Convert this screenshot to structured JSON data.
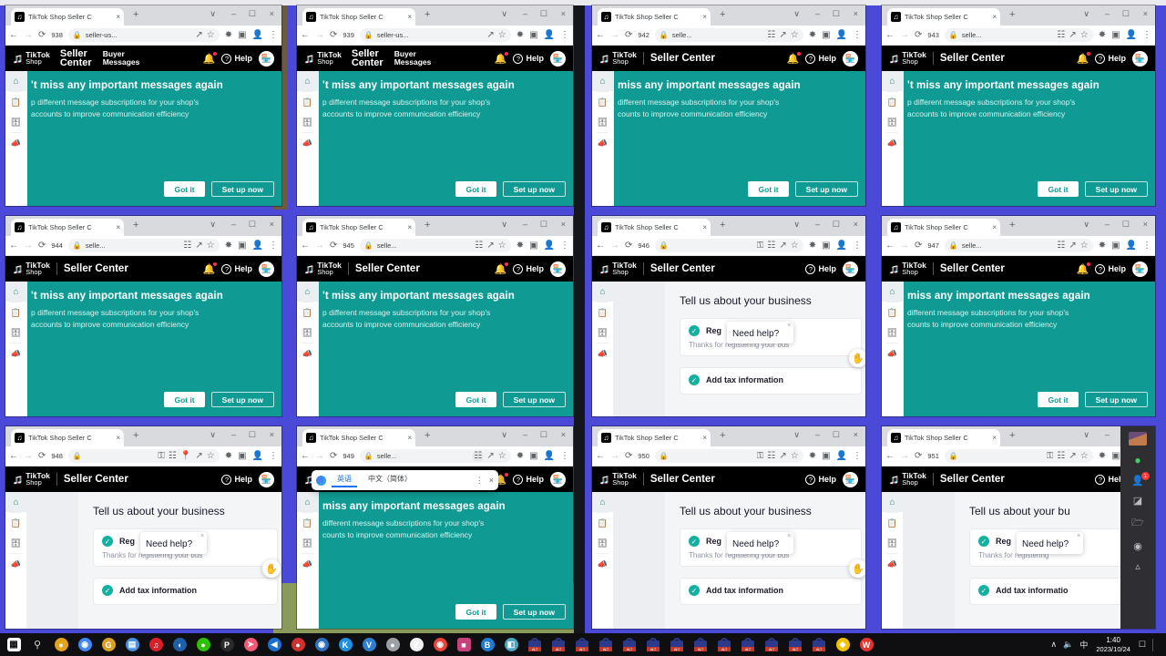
{
  "desktop": {
    "wallpaper_note": "multiple overlapping captured browser windows",
    "accent_teal": "#0f9b93",
    "accent_blue": "#4b49d8",
    "taskbar_bg": "#0f0f12"
  },
  "browser": {
    "tab_title": "TikTok Shop Seller C",
    "tab_favicon": "tiktok-icon",
    "new_tab_label": "+",
    "close_label": "×",
    "window_controls": [
      "∨",
      "–",
      "□",
      "×"
    ],
    "nav": {
      "back": "←",
      "forward": "→",
      "reload": "C",
      "lock": "🔒",
      "key": "⚷",
      "translate": "translate-icon",
      "location": "📍",
      "share": "share-icon",
      "star": "☆",
      "extensions": "✦",
      "sidepanel": "▣",
      "profile": "👤",
      "menu": "⋮"
    },
    "url_short": "seller-us...",
    "url_shorter": "selle..."
  },
  "tiktok_header": {
    "brand_top": "TikTok",
    "brand_bottom": "Shop",
    "seller_center": "Seller Center",
    "seller_word_1": "Seller",
    "seller_word_2": "Center",
    "buyer_messages_1": "Buyer",
    "buyer_messages_2": "Messages",
    "help": "Help",
    "bell_icon": "bell-icon",
    "question_icon": "question-mark-icon",
    "shop_icon": "shop-icon"
  },
  "side_rail": {
    "items": [
      {
        "name": "home",
        "glyph": "⌂"
      },
      {
        "name": "orders",
        "glyph": "Ὄb"
      },
      {
        "name": "products",
        "glyph": "▤"
      },
      {
        "name": "marketing",
        "glyph": "📢"
      }
    ]
  },
  "promo_banner": {
    "heading": "'t miss any important messages again",
    "heading_alt": "miss any important messages again",
    "line1": "p different message subscriptions for your shop's",
    "line1_alt": "different message subscriptions for your shop's",
    "line2": "accounts to improve communication efficiency",
    "line2_alt": "counts to improve communication efficiency",
    "btn_got_it": "Got it",
    "btn_set_up": "Set up now"
  },
  "business_page": {
    "heading": "Tell us about your business",
    "heading_truncated": "Tell us about your bu",
    "card1_label": "Reg",
    "card1_sub": "Thanks for registering your bus",
    "card1_sub_short": "Thanks for registering",
    "card2_label": "Add tax information",
    "card2_label_short": "Add ta",
    "card2_label_alt": "Add tax informatio",
    "need_help": "Need help?",
    "need_help_close": "×",
    "cursor_icon": "hand-cursor-icon"
  },
  "translate_popup": {
    "source_lang": "英语",
    "target_lang": "中文（简体）",
    "more": "⋮",
    "close": "×",
    "icon": "google-translate-icon"
  },
  "wechat_rail": {
    "avatar": "user-avatar",
    "icons": [
      "chat-icon",
      "contacts-icon",
      "discover-icon",
      "files-icon",
      "settings-icon",
      "mini-program-icon"
    ],
    "contacts_badge": "1"
  },
  "panels": [
    {
      "id": 1,
      "counter": "938",
      "url": "seller-us...",
      "header": "two-line",
      "content": "promo",
      "row": 0,
      "col": 0
    },
    {
      "id": 2,
      "counter": "939",
      "url": "seller-us...",
      "header": "two-line",
      "content": "promo",
      "row": 0,
      "col": 1
    },
    {
      "id": 3,
      "counter": "942",
      "url": "selle...",
      "header": "one-line",
      "content": "promo2",
      "row": 0,
      "col": 2
    },
    {
      "id": 4,
      "counter": "943",
      "url": "selle...",
      "header": "one-line",
      "content": "promo",
      "row": 0,
      "col": 3
    },
    {
      "id": 5,
      "counter": "944",
      "url": "selle...",
      "header": "one-line",
      "content": "promo",
      "row": 1,
      "col": 0
    },
    {
      "id": 6,
      "counter": "945",
      "url": "selle...",
      "header": "one-line",
      "content": "promo",
      "row": 1,
      "col": 1
    },
    {
      "id": 7,
      "counter": "946",
      "url": "",
      "header": "nobell",
      "content": "biz",
      "row": 1,
      "col": 2
    },
    {
      "id": 8,
      "counter": "947",
      "url": "selle...",
      "header": "one-line",
      "content": "promo2",
      "row": 1,
      "col": 3
    },
    {
      "id": 9,
      "counter": "948",
      "url": "",
      "header": "nobell",
      "content": "biz",
      "row": 2,
      "col": 0
    },
    {
      "id": 10,
      "counter": "949",
      "url": "selle...",
      "header": "one-line",
      "content": "promo2",
      "row": 2,
      "col": 1
    },
    {
      "id": 11,
      "counter": "950",
      "url": "",
      "header": "nobell",
      "content": "biz",
      "row": 2,
      "col": 2
    },
    {
      "id": 12,
      "counter": "951",
      "url": "",
      "header": "nobell",
      "content": "biz",
      "row": 2,
      "col": 3
    }
  ],
  "taskbar": {
    "start_icon": "windows-start-icon",
    "search_icon": "search-icon",
    "pinned_icons": [
      {
        "name": "app-yellow-bear",
        "glyph": "●",
        "color": "#e3a21a"
      },
      {
        "name": "chrome-canary-icon",
        "glyph": "◉",
        "color": "#4285f4"
      },
      {
        "name": "app-g-icon",
        "glyph": "G",
        "color": "#d8a226"
      },
      {
        "name": "app-doc-icon",
        "glyph": "▤",
        "color": "#4a8fe0"
      },
      {
        "name": "netease-music-icon",
        "glyph": "♫",
        "color": "#d8202a"
      },
      {
        "name": "app-blue-swirl-icon",
        "glyph": "◖",
        "color": "#1e5fa8"
      },
      {
        "name": "wechat-icon",
        "glyph": "●",
        "color": "#2dc100"
      },
      {
        "name": "app-p-icon",
        "glyph": "P",
        "color": "#2b2b2b"
      },
      {
        "name": "app-send-icon",
        "glyph": "➤",
        "color": "#f05a75"
      },
      {
        "name": "app-bird-icon",
        "glyph": "◀",
        "color": "#1c6fd0"
      },
      {
        "name": "app-penguin-icon",
        "glyph": "●",
        "color": "#cf3030"
      },
      {
        "name": "app-blue-g-icon",
        "glyph": "◉",
        "color": "#2f6fc0"
      },
      {
        "name": "kugou-icon",
        "glyph": "K",
        "color": "#1f8fe0"
      },
      {
        "name": "app-v-icon",
        "glyph": "V",
        "color": "#2f7fd0"
      },
      {
        "name": "app-gray-icon",
        "glyph": "●",
        "color": "#9aa0a6"
      },
      {
        "name": "app-z-icon",
        "glyph": "Ƶ",
        "color": "#f0f0f0"
      },
      {
        "name": "chrome-icon",
        "glyph": "◉",
        "color": "#ea4335"
      },
      {
        "name": "app-pink-icon",
        "glyph": "■",
        "color": "#c8417a"
      },
      {
        "name": "bitdefender-icon",
        "glyph": "B",
        "color": "#1f7bd0"
      },
      {
        "name": "app-teal-book-icon",
        "glyph": "◧",
        "color": "#4aa7c0"
      }
    ],
    "locked_windows_count": 13,
    "locked_icon_label": "locked-window-icon",
    "extra_icons": [
      {
        "name": "app-rainbow-icon",
        "glyph": "◆",
        "color": "#f2c200"
      },
      {
        "name": "wps-icon",
        "glyph": "W",
        "color": "#e3342f"
      }
    ],
    "tray": {
      "chevron": "∧",
      "volume_icon": "🔊",
      "ime": "中",
      "time": "1:40",
      "date": "2023/10/24",
      "notification_icon": "notification-icon"
    }
  }
}
